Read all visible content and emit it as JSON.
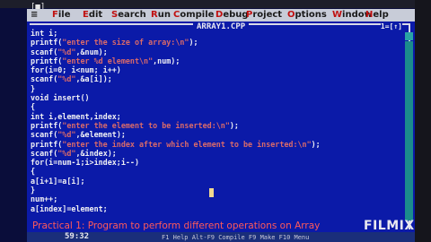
{
  "top_strip": "[■]",
  "menu": {
    "system_icon": "≡",
    "items": [
      {
        "hot": "F",
        "rest": "ile"
      },
      {
        "hot": "E",
        "rest": "dit"
      },
      {
        "hot": "S",
        "rest": "earch"
      },
      {
        "hot": "R",
        "rest": "un"
      },
      {
        "hot": "C",
        "rest": "ompile"
      },
      {
        "hot": "D",
        "rest": "ebug"
      },
      {
        "hot": "P",
        "rest": "roject"
      },
      {
        "hot": "O",
        "rest": "ptions"
      },
      {
        "hot": "W",
        "rest": "indow"
      },
      {
        "hot": "H",
        "rest": "elp"
      }
    ]
  },
  "editor": {
    "file_name": "ARRAY1.CPP",
    "window_number": "1=[↑]",
    "code": [
      {
        "pre": "int i;",
        "str": "",
        "post": ""
      },
      {
        "pre": "printf(",
        "str": "\"enter the size of array:\\n\"",
        "post": ");"
      },
      {
        "pre": "scanf(",
        "str": "\"%d\"",
        "post": ",&num);"
      },
      {
        "pre": "printf(",
        "str": "\"enter %d element\\n\"",
        "post": ",num);"
      },
      {
        "pre": "for(i=0; i<num; i++)",
        "str": "",
        "post": ""
      },
      {
        "pre": "scanf(",
        "str": "\"%d\"",
        "post": ",&a[i]);"
      },
      {
        "pre": "}",
        "str": "",
        "post": ""
      },
      {
        "pre": "void insert()",
        "str": "",
        "post": ""
      },
      {
        "pre": "{",
        "str": "",
        "post": ""
      },
      {
        "pre": "int i,element,index;",
        "str": "",
        "post": ""
      },
      {
        "pre": "printf(",
        "str": "\"enter the element to be inserted:\\n\"",
        "post": ");"
      },
      {
        "pre": "scanf(",
        "str": "\"%d\"",
        "post": ",&element);"
      },
      {
        "pre": "printf(",
        "str": "\"enter the index after which element to be inserted:\\n\"",
        "post": ");"
      },
      {
        "pre": "scanf(",
        "str": "\"%d\"",
        "post": ",&index);"
      },
      {
        "pre": "for(i=num-1;i>index;i--)",
        "str": "",
        "post": ""
      },
      {
        "pre": "{",
        "str": "",
        "post": ""
      },
      {
        "pre": "a[i+1]=a[i];",
        "str": "",
        "post": ""
      },
      {
        "pre": "}",
        "str": "",
        "post": ""
      },
      {
        "pre": "num++;",
        "str": "",
        "post": ""
      },
      {
        "pre": "a[index]=element;",
        "str": "",
        "post": ""
      }
    ]
  },
  "caption": "Practical 1: Program to perform different operations on Array",
  "status": {
    "position": "59:32",
    "keys": "F1 Help  Alt-F9 Compile  F9 Make  F10 Menu"
  },
  "watermark": "FILMIX",
  "colors": {
    "editor_bg": "#0b1aa8",
    "menu_bg": "#c8ccd8",
    "menu_hotkey": "#c01010",
    "string_literal": "#d96a6a",
    "caption": "#ff5a5a"
  }
}
